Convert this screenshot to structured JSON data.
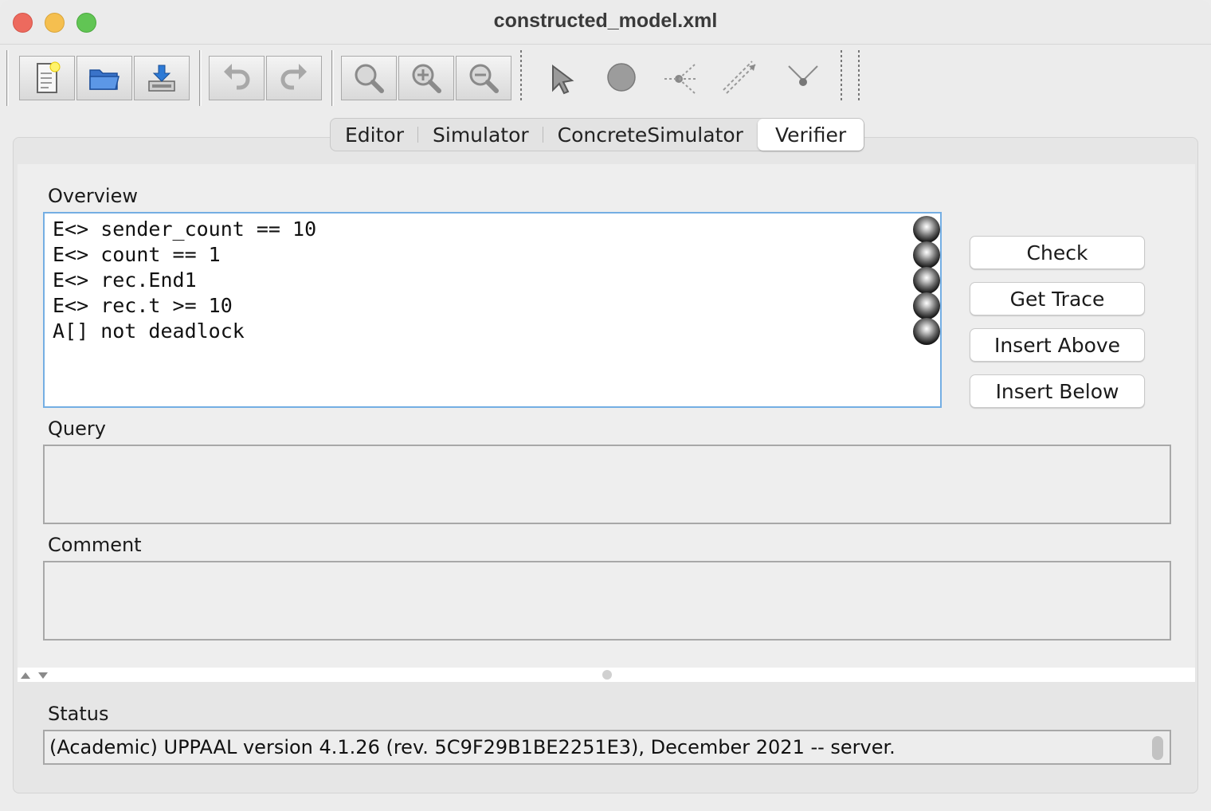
{
  "window": {
    "title": "constructed_model.xml"
  },
  "toolbar": {
    "buttons": [
      {
        "icon": "new-document-icon"
      },
      {
        "icon": "open-folder-icon"
      },
      {
        "icon": "save-icon"
      },
      {
        "icon": "undo-icon"
      },
      {
        "icon": "redo-icon"
      },
      {
        "icon": "zoom-fit-icon"
      },
      {
        "icon": "zoom-in-icon"
      },
      {
        "icon": "zoom-out-icon"
      },
      {
        "icon": "select-pointer-icon"
      },
      {
        "icon": "add-location-icon"
      },
      {
        "icon": "add-branch-point-icon"
      },
      {
        "icon": "add-edge-icon"
      },
      {
        "icon": "add-nail-icon"
      }
    ]
  },
  "tabs": [
    {
      "label": "Editor"
    },
    {
      "label": "Simulator"
    },
    {
      "label": "ConcreteSimulator"
    },
    {
      "label": "Verifier",
      "active": true
    }
  ],
  "verifier": {
    "overview_label": "Overview",
    "queries": [
      {
        "text": "E<> sender_count == 10"
      },
      {
        "text": "E<> count == 1"
      },
      {
        "text": "E<> rec.End1"
      },
      {
        "text": "E<> rec.t >= 10"
      },
      {
        "text": "A[] not deadlock"
      }
    ],
    "buttons": {
      "check": "Check",
      "get_trace": "Get Trace",
      "insert_above": "Insert Above",
      "insert_below": "Insert Below"
    },
    "query_label": "Query",
    "query_value": "",
    "comment_label": "Comment",
    "comment_value": "",
    "status_label": "Status",
    "status_text": "(Academic) UPPAAL version 4.1.26 (rev. 5C9F29B1BE2251E3), December 2021 -- server."
  }
}
